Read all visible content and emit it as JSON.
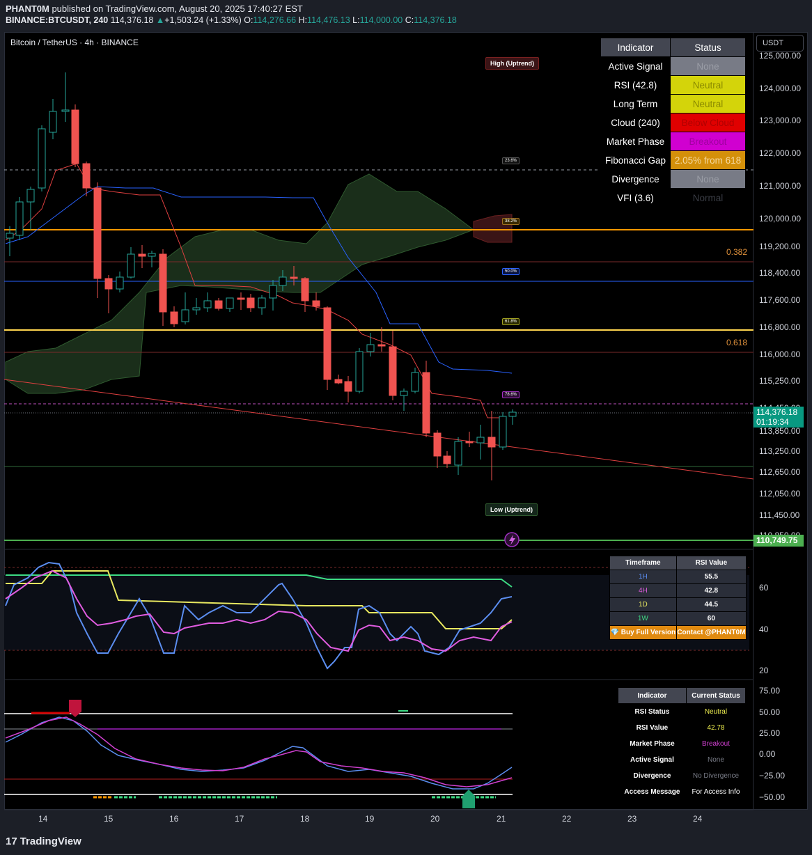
{
  "header": {
    "publisher": "PHANT0M",
    "published_text": " published on TradingView.com, August 20, 2025 17:40:27 EST",
    "symbol": "BINANCE:BTCUSDT, 240",
    "last": "114,376.18",
    "arrow": "▲",
    "change": "+1,503.24 (+1.33%)",
    "o_label": "O:",
    "o_val": "114,276.66",
    "h_label": "H:",
    "h_val": "114,476.13",
    "l_label": "L:",
    "l_val": "114,000.00",
    "c_label": "C:",
    "c_val": "114,376.18"
  },
  "legend": {
    "title": "Bitcoin / TetherUS · 4h · BINANCE"
  },
  "currency_button": "USDT",
  "price_axis": [
    "125,000.00",
    "124,000.00",
    "123,000.00",
    "122,000.00",
    "121,000.00",
    "120,000.00",
    "119,200.00",
    "118,400.00",
    "117,600.00",
    "116,800.00",
    "116,000.00",
    "115,250.00",
    "114,450.00",
    "113,850.00",
    "113,250.00",
    "112,650.00",
    "112,050.00",
    "111,450.00",
    "110,850.00"
  ],
  "last_price": {
    "value": "114,376.18",
    "countdown": "01:19:34"
  },
  "green_price": "110,749.75",
  "fib_side": {
    "f382": "0.382",
    "f618": "0.618"
  },
  "fib_tags": {
    "t236": "23.6%",
    "t382": "38.2%",
    "t500": "50.0%",
    "t618": "61.8%",
    "t786": "78.6%"
  },
  "zone_tags": {
    "high": "High (Uptrend)",
    "low": "Low (Uptrend)"
  },
  "main_table": {
    "headers": [
      "Indicator",
      "Status"
    ],
    "rows": [
      {
        "label": "Active Signal",
        "status": "None",
        "bg": "#787b86",
        "fg": "#9a9da6"
      },
      {
        "label": "RSI (42.8)",
        "status": "Neutral",
        "bg": "#d4d40a",
        "fg": "#8a8a00"
      },
      {
        "label": "Long Term",
        "status": "Neutral",
        "bg": "#d4d40a",
        "fg": "#8a8a00"
      },
      {
        "label": "Cloud (240)",
        "status": "Below Cloud",
        "bg": "#e00000",
        "fg": "#b00000"
      },
      {
        "label": "Market Phase",
        "status": "Breakout",
        "bg": "#d000d0",
        "fg": "#a000a0"
      },
      {
        "label": "Fibonacci Gap",
        "status": "2.05% from 618",
        "bg": "#d4900a",
        "fg": "#f5d9a0"
      },
      {
        "label": "Divergence",
        "status": "None",
        "bg": "#787b86",
        "fg": "#9a9da6"
      },
      {
        "label": "VFI (3.6)",
        "status": "Normal",
        "bg": "#000000",
        "fg": "#3a3d45"
      }
    ]
  },
  "rsi_table": {
    "headers": [
      "Timeframe",
      "RSI Value"
    ],
    "rows": [
      {
        "tf": "1H",
        "val": "55.5",
        "color": "#5b8def"
      },
      {
        "tf": "4H",
        "val": "42.8",
        "color": "#e05ce0"
      },
      {
        "tf": "1D",
        "val": "44.5",
        "color": "#e8e860"
      },
      {
        "tf": "1W",
        "val": "60",
        "color": "#3ddc84"
      }
    ],
    "footer_left": "💎 Buy Full Version",
    "footer_right": "Contact @PHANT0M"
  },
  "rsi_axis": [
    "60",
    "40",
    "20"
  ],
  "osc_table": {
    "headers": [
      "Indicator",
      "Current Status"
    ],
    "rows": [
      {
        "label": "RSI Status",
        "val": "Neutral",
        "color": "#f0f050"
      },
      {
        "label": "RSI Value",
        "val": "42.78",
        "color": "#f0f050"
      },
      {
        "label": "Market Phase",
        "val": "Breakout",
        "color": "#d040d0"
      },
      {
        "label": "Active Signal",
        "val": "None",
        "color": "#787b86"
      },
      {
        "label": "Divergence",
        "val": "No Divergence",
        "color": "#787b86"
      },
      {
        "label": "Access Message",
        "val": "For Access Info",
        "color": "#ffffff"
      }
    ]
  },
  "osc_axis": [
    "75.00",
    "50.00",
    "25.00",
    "0.00",
    "−25.00",
    "−50.00"
  ],
  "time_axis": [
    "14",
    "15",
    "16",
    "17",
    "18",
    "19",
    "20",
    "21",
    "22",
    "23",
    "24"
  ],
  "footer": {
    "brand": "TradingView",
    "mark": "17"
  },
  "colors": {
    "up": "#26a69a",
    "down": "#f05350",
    "accent": "#2962ff"
  }
}
